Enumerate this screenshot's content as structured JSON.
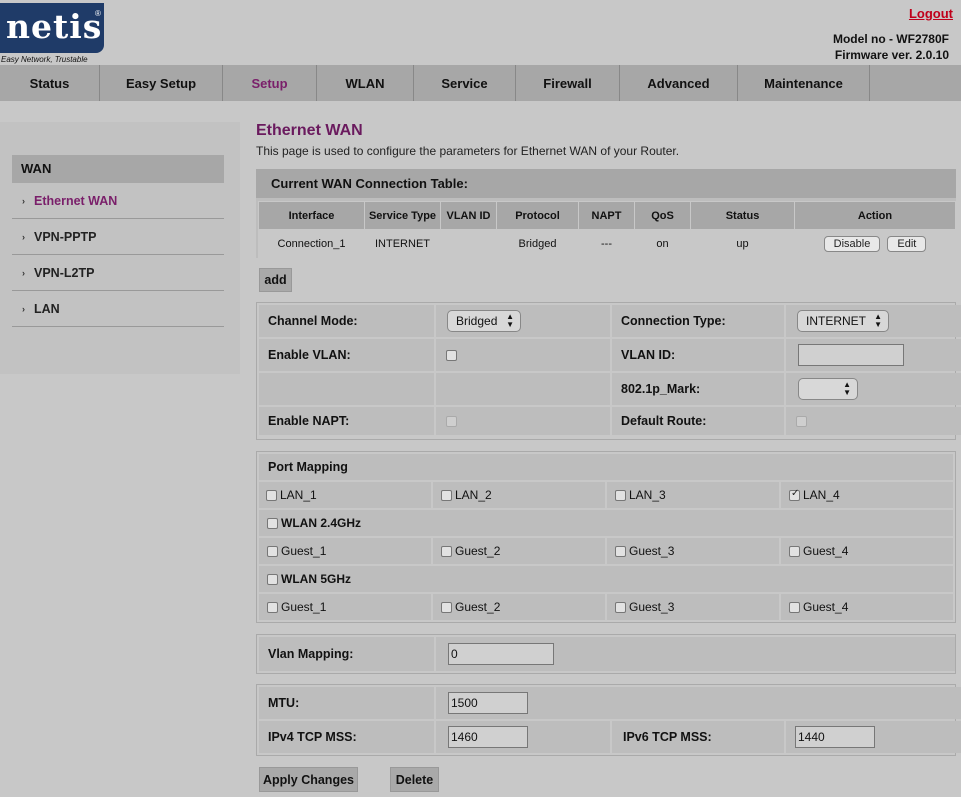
{
  "header": {
    "logo_text": "netis",
    "logo_reg": "®",
    "tagline": "Easy Network, Trustable",
    "logout": "Logout",
    "model": "Model no - WF2780F",
    "firmware": "Firmware ver. 2.0.10"
  },
  "nav": {
    "items": [
      "Status",
      "Easy Setup",
      "Setup",
      "WLAN",
      "Service",
      "Firewall",
      "Advanced",
      "Maintenance"
    ],
    "active": "Setup"
  },
  "sidebar": {
    "heading": "WAN",
    "items": [
      "Ethernet WAN",
      "VPN-PPTP",
      "VPN-L2TP",
      "LAN"
    ],
    "bullet": "›"
  },
  "page": {
    "title": "Ethernet WAN",
    "description": "This page is used to configure the parameters for Ethernet WAN of your Router."
  },
  "wan_table": {
    "title": "Current WAN Connection Table:",
    "headers": [
      "Interface",
      "Service Type",
      "VLAN ID",
      "Protocol",
      "NAPT",
      "QoS",
      "Status",
      "Action"
    ],
    "row": {
      "interface": "Connection_1",
      "service_type": "INTERNET",
      "vlan_id": "",
      "protocol": "Bridged",
      "napt": "---",
      "qos": "on",
      "status": "up",
      "disable": "Disable",
      "edit": "Edit"
    }
  },
  "add_button": "add",
  "config": {
    "channel_mode_label": "Channel Mode:",
    "channel_mode_value": "Bridged",
    "connection_type_label": "Connection Type:",
    "connection_type_value": "INTERNET",
    "enable_vlan_label": "Enable VLAN:",
    "vlan_id_label": "VLAN ID:",
    "vlan_id_value": "",
    "mark_label": "802.1p_Mark:",
    "mark_value": "",
    "enable_napt_label": "Enable NAPT:",
    "default_route_label": "Default Route:"
  },
  "port_mapping": {
    "title": "Port Mapping",
    "lan": [
      "LAN_1",
      "LAN_2",
      "LAN_3",
      "LAN_4"
    ],
    "lan_checked": [
      false,
      false,
      false,
      true
    ],
    "wlan24_label": "WLAN 2.4GHz",
    "wlan24_guests": [
      "Guest_1",
      "Guest_2",
      "Guest_3",
      "Guest_4"
    ],
    "wlan5_label": "WLAN 5GHz",
    "wlan5_guests": [
      "Guest_1",
      "Guest_2",
      "Guest_3",
      "Guest_4"
    ]
  },
  "vlan_mapping": {
    "label": "Vlan Mapping:",
    "value": "0"
  },
  "mtu": {
    "mtu_label": "MTU:",
    "mtu_value": "1500",
    "ipv4_label": "IPv4 TCP MSS:",
    "ipv4_value": "1460",
    "ipv6_label": "IPv6 TCP MSS:",
    "ipv6_value": "1440"
  },
  "actions": {
    "apply": "Apply Changes",
    "delete": "Delete"
  }
}
